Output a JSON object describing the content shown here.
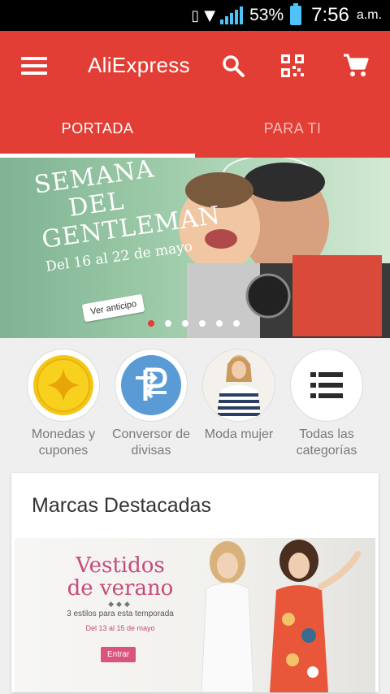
{
  "status_bar": {
    "battery_percent": "53%",
    "time": "7:56",
    "ampm": "a.m."
  },
  "toolbar": {
    "title": "AliExpress",
    "icons": [
      "menu-icon",
      "search-icon",
      "qr-code-icon",
      "cart-icon"
    ]
  },
  "tabs": [
    {
      "label": "PORTADA",
      "active": true
    },
    {
      "label": "PARA TI",
      "active": false
    }
  ],
  "banner": {
    "lines": [
      "SEMANA",
      "DEL",
      "GENTLEMAN"
    ],
    "dates": "Del 16 al 22 de mayo",
    "button_label": "Ver anticipo",
    "page_count": 6,
    "active_page": 1
  },
  "categories": [
    {
      "line1": "Monedas y",
      "line2": "cupones",
      "icon": "coin-icon"
    },
    {
      "line1": "Conversor de",
      "line2": "divisas",
      "icon": "currency-converter-icon"
    },
    {
      "line1": "Moda mujer",
      "line2": "",
      "icon": "fashion-woman-image"
    },
    {
      "line1": "Todas las",
      "line2": "categorías",
      "icon": "list-icon"
    }
  ],
  "featured": {
    "title": "Marcas Destacadas",
    "promo": {
      "title_line1": "Vestidos",
      "title_line2": "de verano",
      "dots": "◆◆◆",
      "subtitle": "3 estilos para esta temporada",
      "dates": "Del 13 al 15 de mayo",
      "button_label": "Entrar"
    }
  },
  "colors": {
    "brand_red": "#e23e35",
    "accent_blue": "#4fc3f7",
    "promo_pink": "#c74a7a"
  }
}
